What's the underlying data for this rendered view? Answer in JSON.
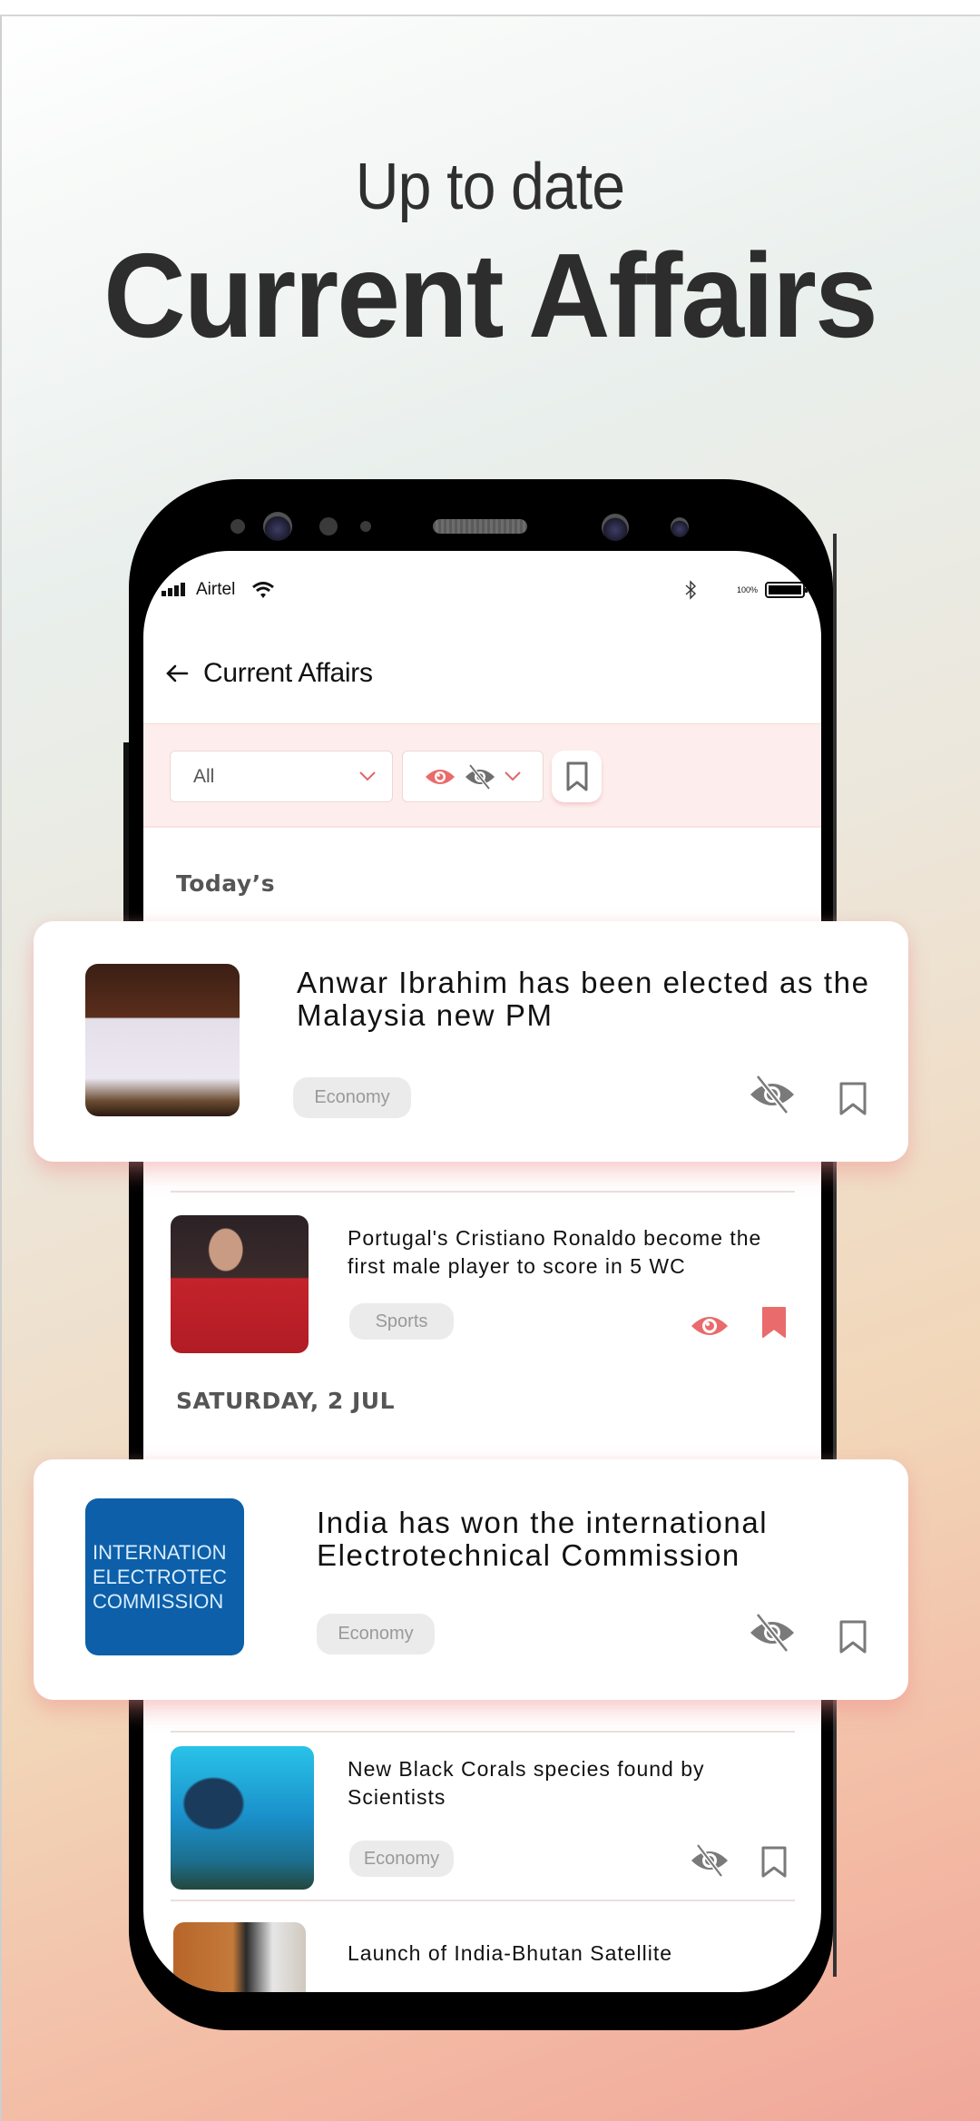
{
  "hero": {
    "subtitle": "Up to date",
    "title": "Current Affairs"
  },
  "status_bar": {
    "carrier": "Airtel",
    "battery_percent": "100%",
    "icons": [
      "signal-icon",
      "wifi-icon",
      "bluetooth-icon",
      "battery-icon"
    ]
  },
  "app_bar": {
    "back_icon": "arrow-left-icon",
    "title": "Current Affairs"
  },
  "filters": {
    "category": {
      "selected": "All",
      "icon": "chevron-down-icon"
    },
    "read_filter": {
      "icons": [
        "eye-icon",
        "eye-off-icon",
        "chevron-down-icon"
      ]
    },
    "bookmark_filter_icon": "bookmark-outline-icon"
  },
  "sections": [
    {
      "label": "Today’s",
      "items": [
        {
          "headline": "Anwar Ibrahim has been elected as the Malaysia new PM",
          "tag": "Economy",
          "read": false,
          "bookmarked": false,
          "highlighted": true,
          "image": "Anwar Ibrahim signing document"
        },
        {
          "headline": "Portugal's Cristiano Ronaldo become the first male player to score in 5 WC",
          "tag": "Sports",
          "read": true,
          "bookmarked": true,
          "highlighted": false,
          "image": "Cristiano Ronaldo in red jersey"
        }
      ]
    },
    {
      "label": "SATURDAY, 2 JUL",
      "items": [
        {
          "headline": "India has won the international Electrotechnical Commission",
          "tag": "Economy",
          "read": false,
          "bookmarked": false,
          "highlighted": true,
          "image_text": [
            "INTERNATION",
            "ELECTROTEC",
            "COMMISSION"
          ]
        },
        {
          "headline": "New Black Corals species found by Scientists",
          "tag": "Economy",
          "read": false,
          "bookmarked": false,
          "highlighted": false,
          "image": "Black coral underwater"
        },
        {
          "headline": "Launch of India-Bhutan Satellite",
          "image": "Leaders of India and Bhutan"
        }
      ]
    }
  ],
  "colors": {
    "accent": "#e96b6b",
    "filter_bg": "#fdeeed",
    "icon_gray": "#777777",
    "tag_bg": "#ebebeb",
    "text": "#111111"
  }
}
